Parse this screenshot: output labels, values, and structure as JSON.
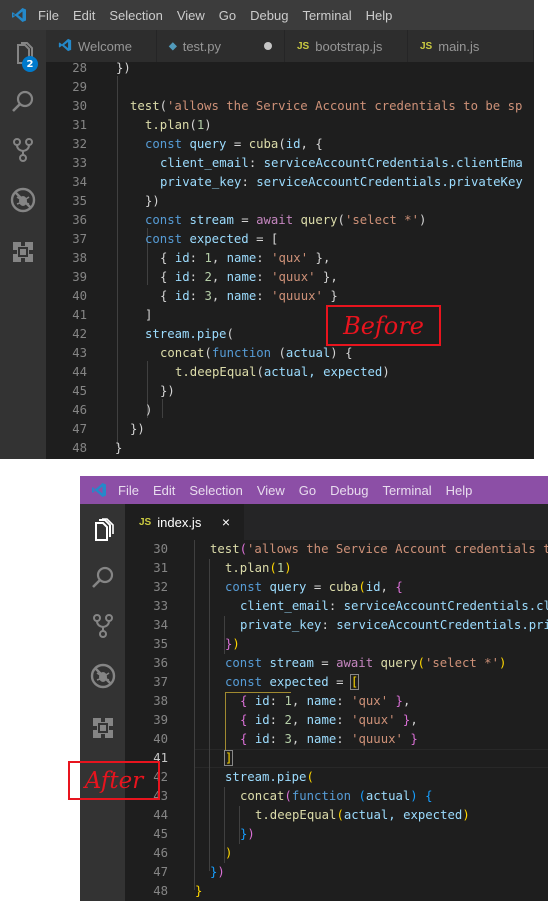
{
  "menu": [
    "File",
    "Edit",
    "Selection",
    "View",
    "Go",
    "Debug",
    "Terminal",
    "Help"
  ],
  "before": {
    "label": "Before",
    "badge_count": "2",
    "tabs": [
      {
        "icon": "vscode-logo-icon",
        "label": "Welcome",
        "state": ""
      },
      {
        "icon": "python-file-icon",
        "label": "test.py",
        "state": "unsaved"
      },
      {
        "icon": "js-file-icon",
        "icon_text": "JS",
        "label": "bootstrap.js",
        "state": ""
      },
      {
        "icon": "js-file-icon",
        "icon_text": "JS",
        "label": "main.js",
        "state": ""
      }
    ],
    "line_numbers": [
      "28",
      "29",
      "30",
      "31",
      "32",
      "33",
      "34",
      "35",
      "36",
      "37",
      "38",
      "39",
      "40",
      "41",
      "42",
      "43",
      "44",
      "45",
      "46",
      "47",
      "48"
    ]
  },
  "after": {
    "label": "After",
    "title_bar_color": "#8c4fa6",
    "tabs": [
      {
        "icon": "js-file-icon",
        "icon_text": "JS",
        "label": "index.js",
        "state": "active",
        "close": "×"
      }
    ],
    "line_numbers": [
      "30",
      "31",
      "32",
      "33",
      "34",
      "35",
      "36",
      "37",
      "38",
      "39",
      "40",
      "41",
      "42",
      "43",
      "44",
      "45",
      "46",
      "47",
      "48"
    ]
  },
  "code": {
    "l28": "})",
    "l30_fn": "test",
    "l30_str": "'allows the Service Account credentials to be sp",
    "l31": "t.plan",
    "l31_num": "1",
    "l32_kw": "const",
    "l32_var": "query",
    "l32_fn": "cuba",
    "l32_arg": "id",
    "l33_key": "client_email",
    "l33_val": "serviceAccountCredentials.clientEma",
    "l34_key": "private_key",
    "l34_val": "serviceAccountCredentials.privateKey",
    "l36_var": "stream",
    "l36_await": "await",
    "l36_fn": "query",
    "l36_str": "'select *'",
    "l37_var": "expected",
    "rows": [
      {
        "id": "1",
        "name": "'qux'",
        "tail": ","
      },
      {
        "id": "2",
        "name": "'quux'",
        "tail": ","
      },
      {
        "id": "3",
        "name": "'quuux'",
        "tail": ""
      }
    ],
    "l42": "stream.pipe",
    "l43_fn": "concat",
    "l43_kw": "function",
    "l43_arg": "actual",
    "l44_fn": "t.deepEqual",
    "l44_args": "actual, expected"
  }
}
